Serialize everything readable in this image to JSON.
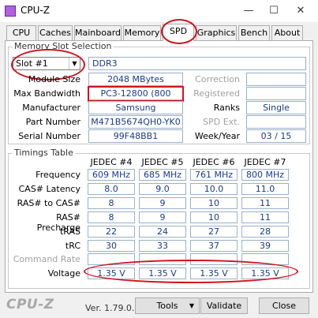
{
  "window": {
    "title": "CPU-Z",
    "minimize": "—",
    "maximize": "☐",
    "close": "✕"
  },
  "tabs": [
    "CPU",
    "Caches",
    "Mainboard",
    "Memory",
    "SPD",
    "Graphics",
    "Bench",
    "About"
  ],
  "active_tab": "SPD",
  "memory_slot": {
    "group_title": "Memory Slot Selection",
    "slot_selected": "Slot #1",
    "memory_type": "DDR3",
    "module_size_label": "Module Size",
    "module_size": "2048 MBytes",
    "max_bandwidth_label": "Max Bandwidth",
    "max_bandwidth": "PC3-12800 (800 MHz)",
    "manufacturer_label": "Manufacturer",
    "manufacturer": "Samsung",
    "part_number_label": "Part Number",
    "part_number": "M471B5674QH0-YK0",
    "serial_number_label": "Serial Number",
    "serial_number": "99F48BB1",
    "correction_label": "Correction",
    "correction": "",
    "registered_label": "Registered",
    "registered": "",
    "ranks_label": "Ranks",
    "ranks": "Single",
    "spd_ext_label": "SPD Ext.",
    "spd_ext": "",
    "week_year_label": "Week/Year",
    "week_year": "03 / 15"
  },
  "timings": {
    "group_title": "Timings Table",
    "columns": [
      "JEDEC #4",
      "JEDEC #5",
      "JEDEC #6",
      "JEDEC #7"
    ],
    "rows": [
      {
        "label": "Frequency",
        "dim": false,
        "values": [
          "609 MHz",
          "685 MHz",
          "761 MHz",
          "800 MHz"
        ]
      },
      {
        "label": "CAS# Latency",
        "dim": false,
        "values": [
          "8.0",
          "9.0",
          "10.0",
          "11.0"
        ]
      },
      {
        "label": "RAS# to CAS#",
        "dim": false,
        "values": [
          "8",
          "9",
          "10",
          "11"
        ]
      },
      {
        "label": "RAS# Precharge",
        "dim": false,
        "values": [
          "8",
          "9",
          "10",
          "11"
        ]
      },
      {
        "label": "tRAS",
        "dim": false,
        "values": [
          "22",
          "24",
          "27",
          "28"
        ]
      },
      {
        "label": "tRC",
        "dim": false,
        "values": [
          "30",
          "33",
          "37",
          "39"
        ]
      },
      {
        "label": "Command Rate",
        "dim": true,
        "values": [
          "",
          "",
          "",
          ""
        ]
      },
      {
        "label": "Voltage",
        "dim": false,
        "values": [
          "1.35 V",
          "1.35 V",
          "1.35 V",
          "1.35 V"
        ]
      }
    ]
  },
  "footer": {
    "logo": "CPU-Z",
    "version": "Ver. 1.79.0.x32",
    "tools_label": "Tools",
    "validate_label": "Validate",
    "close_label": "Close"
  }
}
